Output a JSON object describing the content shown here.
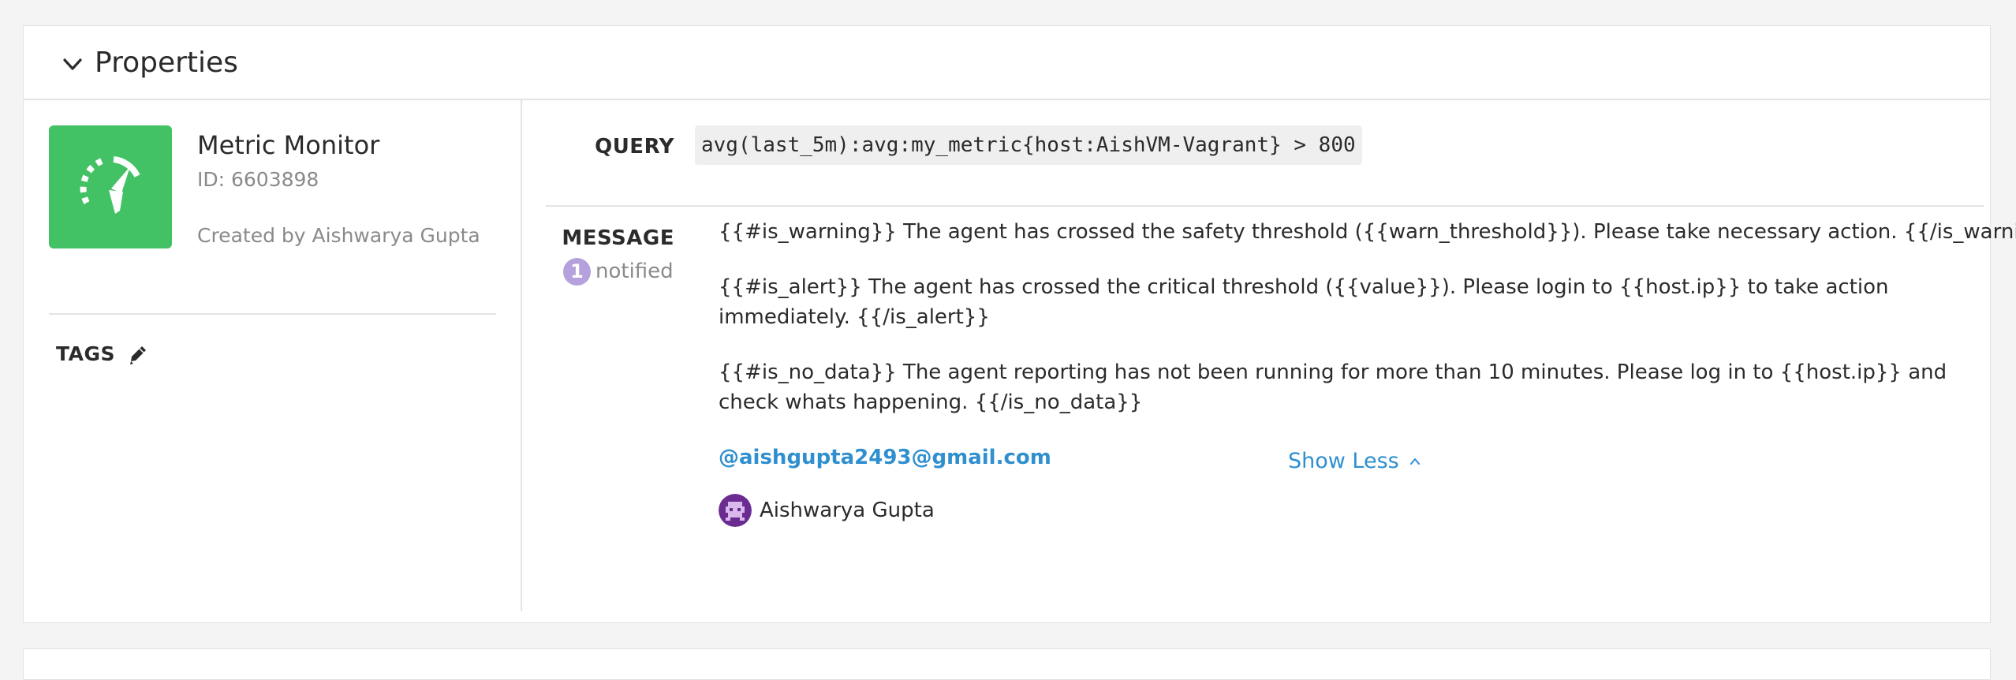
{
  "panel": {
    "title": "Properties",
    "toggle_icon": "chevron-down-icon"
  },
  "monitor": {
    "icon": "speedometer-icon",
    "icon_color": "#42c264",
    "name": "Metric Monitor",
    "id": "ID: 6603898",
    "created_by": "Created by Aishwarya Gupta"
  },
  "tags": {
    "label": "TAGS",
    "edit_icon": "pencil-icon"
  },
  "query": {
    "label": "QUERY",
    "value": "avg(last_5m):avg:my_metric{host:AishVM-Vagrant} > 800"
  },
  "message": {
    "label": "MESSAGE",
    "notified_count": "1",
    "notified_label": "notified",
    "badge_color": "#b5a1db",
    "lines": [
      "{{#is_warning}} The agent has crossed the safety threshold ({{warn_threshold}}). Please take necessary action. {{/is_warning}}",
      "{{#is_alert}} The agent has crossed the critical threshold ({{value}}). Please login to {{host.ip}} to take action immediately. {{/is_alert}}",
      "{{#is_no_data}} The agent reporting has not been running for more than 10 minutes. Please log in to {{host.ip}} and check whats happening. {{/is_no_data}}"
    ],
    "mention": "@aishgupta2493@gmail.com",
    "recipient_name": "Aishwarya Gupta",
    "recipient_avatar": "avatar-icon",
    "link_color": "#2f8fcf"
  },
  "footer": {
    "show_less_label": "Show Less",
    "show_less_icon": "chevron-up-icon"
  }
}
